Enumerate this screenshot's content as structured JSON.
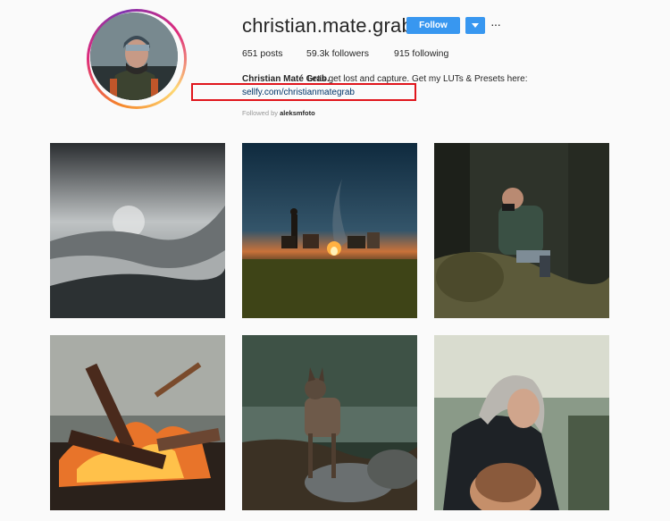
{
  "profile": {
    "username": "christian.mate.grab",
    "follow_label": "Follow",
    "more_label": "···",
    "stats": {
      "posts": "651 posts",
      "followers": "59.3k followers",
      "following": "915 following"
    },
    "bio": {
      "name": "Christian Maté Grab.",
      "text": "Let's get lost and capture. Get my LUTs & Presets here:",
      "link": "sellfy.com/christianmategrab"
    },
    "followed_by": {
      "prefix": "Followed by",
      "user": "aleksmfoto"
    }
  },
  "colors": {
    "follow_button": "#3897f0",
    "highlight_box": "#e0151c",
    "link": "#003569"
  },
  "posts": [
    {
      "subject": "misty-mountains"
    },
    {
      "subject": "campfire-group-dusk"
    },
    {
      "subject": "photographer-in-forest"
    },
    {
      "subject": "burning-logs"
    },
    {
      "subject": "dog-in-creek"
    },
    {
      "subject": "hooded-man-portrait"
    }
  ]
}
